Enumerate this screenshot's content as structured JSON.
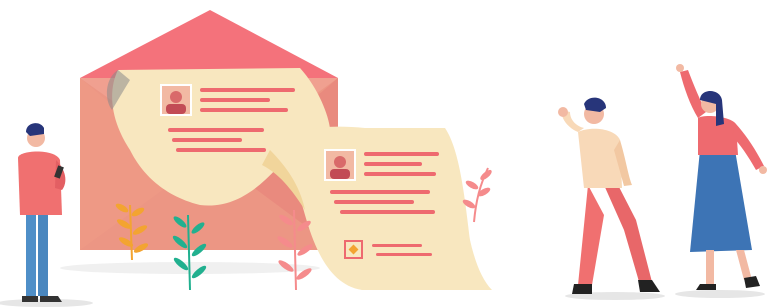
{
  "illustration": {
    "subject": "envelope-with-resumes",
    "colors": {
      "envelope_back": "#f4727b",
      "envelope_body": "#f0a090",
      "envelope_inner": "#e98a7e",
      "paper": "#f8e7bf",
      "paper_shade": "#f1d59b",
      "line_accent": "#ee6a6f",
      "person_shirt_red": "#f07070",
      "person_jeans": "#4f8fc8",
      "person_hair": "#27357a",
      "skin": "#f2b9a3",
      "skirt": "#3d74b5",
      "leaf_orange": "#f3a431",
      "leaf_green": "#21b08f",
      "leaf_pink": "#f58b8c",
      "shadow": "#e6e6e6"
    },
    "icons": [
      "avatar-photo-icon",
      "avatar-photo-icon",
      "badge-icon"
    ]
  }
}
